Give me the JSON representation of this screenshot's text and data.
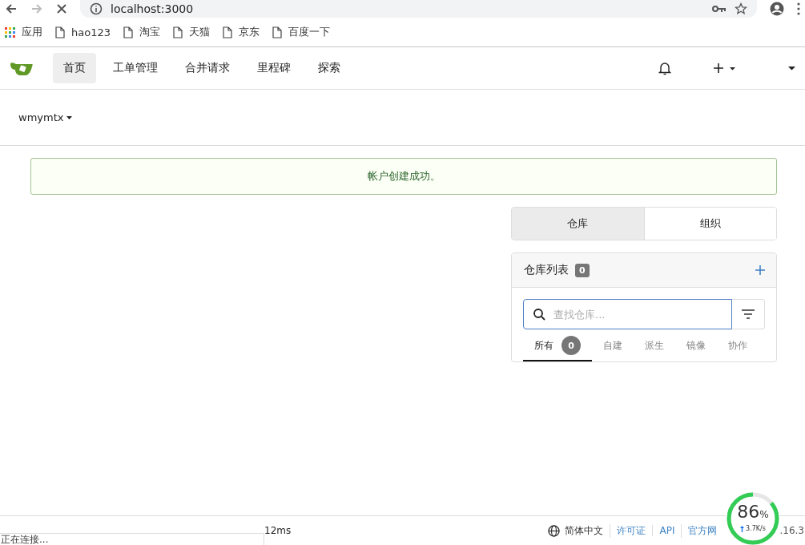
{
  "browser": {
    "address": "localhost:3000",
    "bookmarks": [
      {
        "label": "应用",
        "kind": "apps"
      },
      {
        "label": "hao123",
        "kind": "page"
      },
      {
        "label": "淘宝",
        "kind": "page"
      },
      {
        "label": "天猫",
        "kind": "page"
      },
      {
        "label": "京东",
        "kind": "page"
      },
      {
        "label": "百度一下",
        "kind": "page"
      }
    ]
  },
  "nav": {
    "items": [
      {
        "label": "首页",
        "selected": true
      },
      {
        "label": "工单管理",
        "selected": false
      },
      {
        "label": "合并请求",
        "selected": false
      },
      {
        "label": "里程碑",
        "selected": false
      },
      {
        "label": "探索",
        "selected": false
      }
    ]
  },
  "context": {
    "user": "wmymtx"
  },
  "flash": {
    "message": "帐户创建成功。"
  },
  "tabs": [
    {
      "label": "仓库",
      "selected": true
    },
    {
      "label": "组织",
      "selected": false
    }
  ],
  "repo_list": {
    "title": "仓库列表",
    "count": "0",
    "search": {
      "placeholder": "查找仓库..."
    },
    "filters": [
      {
        "label": "所有",
        "selected": true,
        "count": "0"
      },
      {
        "label": "自建",
        "selected": false
      },
      {
        "label": "派生",
        "selected": false
      },
      {
        "label": "镜像",
        "selected": false
      },
      {
        "label": "协作",
        "selected": false
      }
    ]
  },
  "footer": {
    "left": "12ms",
    "language": "简体中文",
    "links": [
      "许可证",
      "API",
      "官方网"
    ],
    "version": ".16.3"
  },
  "status_bubble": "正在连接...",
  "speed_widget": {
    "percent": "86",
    "unit": "%",
    "rate": "3.7K/s",
    "level": 0.86
  }
}
